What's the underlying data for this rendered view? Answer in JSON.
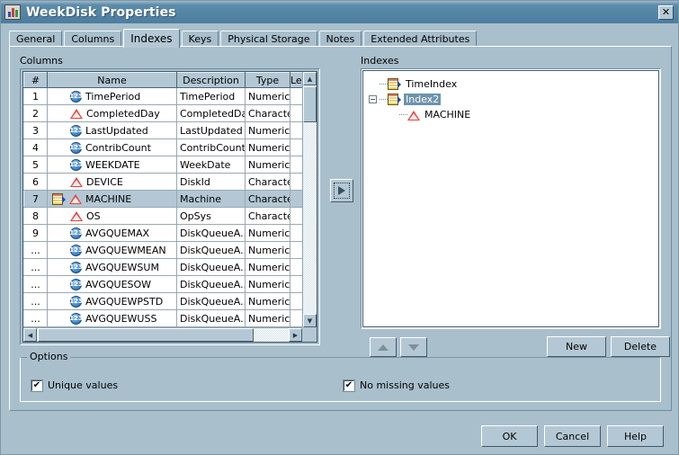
{
  "window": {
    "title": "WeekDisk Properties",
    "icon": "table-properties-icon",
    "close_label": "✕"
  },
  "tabs": [
    {
      "label": "General",
      "active": false
    },
    {
      "label": "Columns",
      "active": false
    },
    {
      "label": "Indexes",
      "active": true
    },
    {
      "label": "Keys",
      "active": false
    },
    {
      "label": "Physical Storage",
      "active": false
    },
    {
      "label": "Notes",
      "active": false
    },
    {
      "label": "Extended Attributes",
      "active": false
    }
  ],
  "columns_panel": {
    "label": "Columns",
    "headers": [
      "#",
      "Name",
      "Description",
      "Type",
      "Len"
    ],
    "rows": [
      {
        "num": "1",
        "name": "TimePeriod",
        "desc": "TimePeriod",
        "type": "Numeric",
        "icon": "numeric-icon",
        "indexed": false,
        "selected": false
      },
      {
        "num": "2",
        "name": "CompletedDay",
        "desc": "CompletedDay",
        "type": "Character",
        "icon": "character-icon",
        "indexed": false,
        "selected": false
      },
      {
        "num": "3",
        "name": "LastUpdated",
        "desc": "LastUpdated",
        "type": "Numeric",
        "icon": "numeric-icon",
        "indexed": false,
        "selected": false
      },
      {
        "num": "4",
        "name": "ContribCount",
        "desc": "ContribCount",
        "type": "Numeric",
        "icon": "numeric-icon",
        "indexed": false,
        "selected": false
      },
      {
        "num": "5",
        "name": "WEEKDATE",
        "desc": "WeekDate",
        "type": "Numeric",
        "icon": "numeric-icon",
        "indexed": false,
        "selected": false
      },
      {
        "num": "6",
        "name": "DEVICE",
        "desc": "DiskId",
        "type": "Character",
        "icon": "character-icon",
        "indexed": false,
        "selected": false
      },
      {
        "num": "7",
        "name": "MACHINE",
        "desc": "Machine",
        "type": "Character",
        "icon": "character-icon",
        "indexed": true,
        "selected": true
      },
      {
        "num": "8",
        "name": "OS",
        "desc": "OpSys",
        "type": "Character",
        "icon": "character-icon",
        "indexed": false,
        "selected": false
      },
      {
        "num": "9",
        "name": "AVGQUEMAX",
        "desc": "DiskQueueA...",
        "type": "Numeric",
        "icon": "numeric-icon",
        "indexed": false,
        "selected": false
      },
      {
        "num": "...",
        "name": "AVGQUEWMEAN",
        "desc": "DiskQueueA...",
        "type": "Numeric",
        "icon": "numeric-icon",
        "indexed": false,
        "selected": false
      },
      {
        "num": "...",
        "name": "AVGQUEWSUM",
        "desc": "DiskQueueA...",
        "type": "Numeric",
        "icon": "numeric-icon",
        "indexed": false,
        "selected": false
      },
      {
        "num": "...",
        "name": "AVGQUESOW",
        "desc": "DiskQueueA...",
        "type": "Numeric",
        "icon": "numeric-icon",
        "indexed": false,
        "selected": false
      },
      {
        "num": "...",
        "name": "AVGQUEWPSTD",
        "desc": "DiskQueueA...",
        "type": "Numeric",
        "icon": "numeric-icon",
        "indexed": false,
        "selected": false
      },
      {
        "num": "...",
        "name": "AVGQUEWUSS",
        "desc": "DiskQueueA...",
        "type": "Numeric",
        "icon": "numeric-icon",
        "indexed": false,
        "selected": false
      }
    ]
  },
  "transfer_button": {
    "name": "add-column-to-index-button",
    "glyph": "▶"
  },
  "indexes_panel": {
    "label": "Indexes",
    "tree": [
      {
        "label": "TimeIndex",
        "level": 0,
        "icon": "index-icon",
        "expander": "",
        "selected": false
      },
      {
        "label": "Index2",
        "level": 0,
        "icon": "index-icon",
        "expander": "−",
        "selected": true
      },
      {
        "label": "MACHINE",
        "level": 1,
        "icon": "character-icon",
        "expander": "",
        "selected": false
      }
    ],
    "nav_up_label": "▲",
    "nav_down_label": "▼",
    "new_label": "New",
    "delete_label": "Delete"
  },
  "options": {
    "legend": "Options",
    "unique_values": {
      "label": "Unique values",
      "checked": true,
      "mark": "✔"
    },
    "no_missing_values": {
      "label": "No missing values",
      "checked": true,
      "mark": "✔"
    }
  },
  "footer": {
    "ok_label": "OK",
    "cancel_label": "Cancel",
    "help_label": "Help"
  },
  "colors": {
    "dialog_bg": "#a9bfcc",
    "titlebar": "#5182a3",
    "control_face": "#b3c8d4",
    "selection": "#6d93ad",
    "grid_line": "#9aa9b2"
  }
}
